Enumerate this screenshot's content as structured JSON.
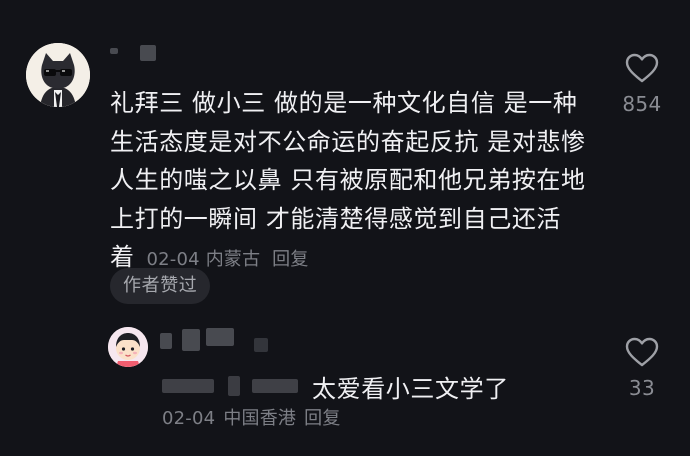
{
  "comment": {
    "text": "礼拜三 做小三 做的是一种文化自信 是一种生活态度是对不公命运的奋起反抗 是对悲惨人生的嗤之以鼻 只有被原配和他兄弟按在地上打的一瞬间 才能清楚得感觉到自己还活着",
    "date": "02-04",
    "location": "内蒙古",
    "reply_label": "回复",
    "badge": "作者赞过",
    "like_count": "854",
    "avatar_icon": "black-cat-sunglasses-avatar"
  },
  "reply": {
    "text": "太爱看小三文学了",
    "date": "02-04",
    "location": "中国香港",
    "reply_label": "回复",
    "like_count": "33",
    "avatar_icon": "cartoon-girl-avatar"
  },
  "colors": {
    "background": "#121318",
    "text": "#f0f0f3",
    "meta": "#7d7f86",
    "badge_bg": "#26272d"
  }
}
